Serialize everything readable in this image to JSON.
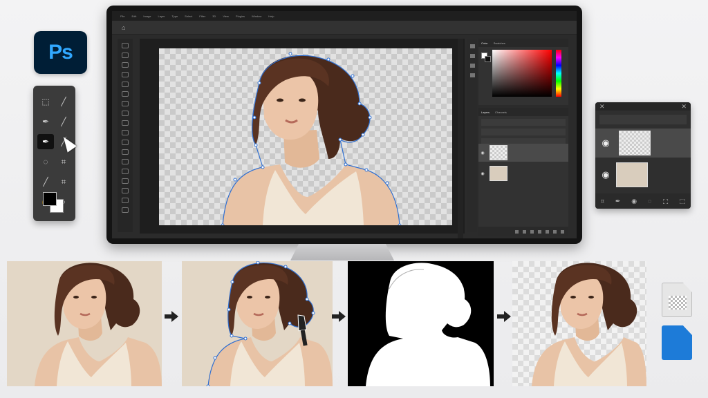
{
  "app": {
    "logo_text": "Ps",
    "accent_color": "#31a8ff",
    "logo_bg": "#001e36"
  },
  "menu": [
    "File",
    "Edit",
    "Image",
    "Layer",
    "Type",
    "Select",
    "Filter",
    "3D",
    "View",
    "Plugins",
    "Window",
    "Help"
  ],
  "panels": {
    "color_tabs": [
      "Color",
      "Swatches"
    ],
    "layers_tabs": [
      "Layers",
      "Channels"
    ]
  },
  "icons": {
    "home": "home-icon",
    "pen_tool": "pen-tool-icon",
    "hand": "hand-icon",
    "zoom": "zoom-icon",
    "eye": "eye-icon"
  },
  "glyphs": {
    "home": "⌂",
    "eye": "◉",
    "close": "✕",
    "hand": "✋",
    "zoom": "⌕",
    "marquee": "⬚",
    "pen": "✒",
    "brush": "╱",
    "lasso": "◌",
    "crop": "⌗"
  },
  "colors": {
    "mask_bg": "#000000",
    "file_blue": "#1d7bd8"
  }
}
